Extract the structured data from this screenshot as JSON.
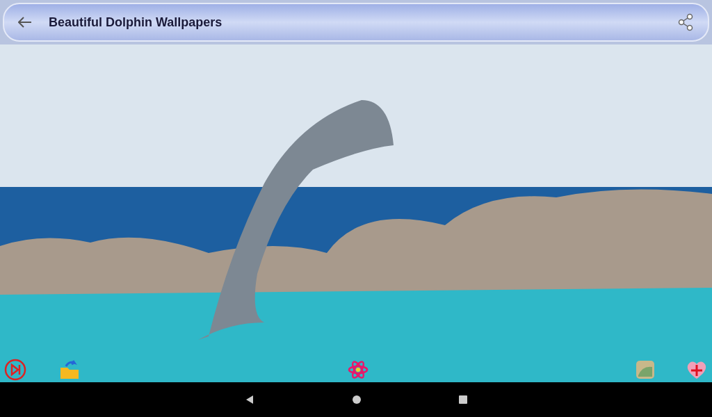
{
  "app_bar": {
    "title": "Beautiful Dolphin Wallpapers"
  }
}
